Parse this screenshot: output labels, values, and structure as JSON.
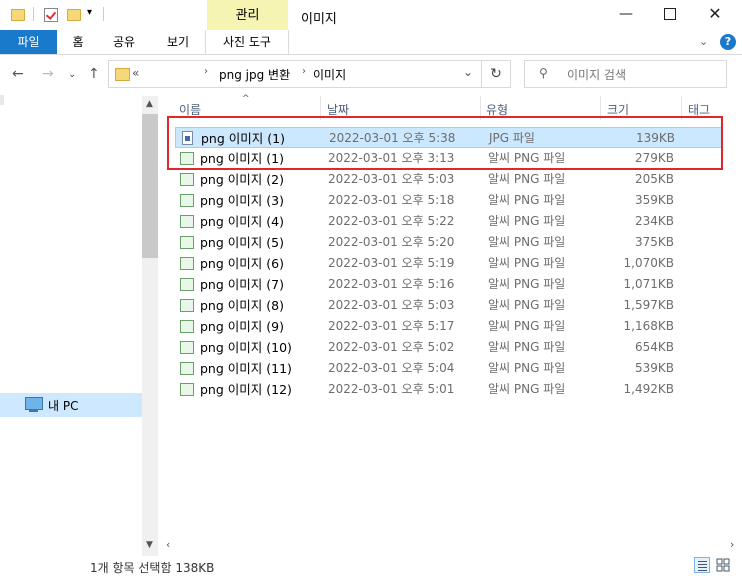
{
  "window": {
    "manage_tab": "관리",
    "title": "이미지"
  },
  "ribbon": {
    "file": "파일",
    "home": "홈",
    "share": "공유",
    "view": "보기",
    "picture_tools": "사진 도구"
  },
  "address": {
    "overflow": "«",
    "crumbs": [
      "png jpg 변환",
      "이미지"
    ],
    "search_placeholder": "이미지 검색"
  },
  "nav": {
    "mypc": "내 PC"
  },
  "columns": {
    "name": "이름",
    "date": "날짜",
    "type": "유형",
    "size": "크기",
    "tag": "태그"
  },
  "files": [
    {
      "name": "png 이미지 (1)",
      "date": "2022-03-01 오후 5:38",
      "type": "JPG 파일",
      "size": "139KB",
      "icon": "jpg-file-icon",
      "selected": true
    },
    {
      "name": "png 이미지 (1)",
      "date": "2022-03-01 오후 3:13",
      "type": "알씨 PNG 파일",
      "size": "279KB",
      "icon": "png-file-icon"
    },
    {
      "name": "png 이미지 (2)",
      "date": "2022-03-01 오후 5:03",
      "type": "알씨 PNG 파일",
      "size": "205KB",
      "icon": "png-file-icon"
    },
    {
      "name": "png 이미지 (3)",
      "date": "2022-03-01 오후 5:18",
      "type": "알씨 PNG 파일",
      "size": "359KB",
      "icon": "png-file-icon"
    },
    {
      "name": "png 이미지 (4)",
      "date": "2022-03-01 오후 5:22",
      "type": "알씨 PNG 파일",
      "size": "234KB",
      "icon": "png-file-icon"
    },
    {
      "name": "png 이미지 (5)",
      "date": "2022-03-01 오후 5:20",
      "type": "알씨 PNG 파일",
      "size": "375KB",
      "icon": "png-file-icon"
    },
    {
      "name": "png 이미지 (6)",
      "date": "2022-03-01 오후 5:19",
      "type": "알씨 PNG 파일",
      "size": "1,070KB",
      "icon": "png-file-icon"
    },
    {
      "name": "png 이미지 (7)",
      "date": "2022-03-01 오후 5:16",
      "type": "알씨 PNG 파일",
      "size": "1,071KB",
      "icon": "png-file-icon"
    },
    {
      "name": "png 이미지 (8)",
      "date": "2022-03-01 오후 5:03",
      "type": "알씨 PNG 파일",
      "size": "1,597KB",
      "icon": "png-file-icon"
    },
    {
      "name": "png 이미지 (9)",
      "date": "2022-03-01 오후 5:17",
      "type": "알씨 PNG 파일",
      "size": "1,168KB",
      "icon": "png-file-icon"
    },
    {
      "name": "png 이미지 (10)",
      "date": "2022-03-01 오후 5:02",
      "type": "알씨 PNG 파일",
      "size": "654KB",
      "icon": "png-file-icon"
    },
    {
      "name": "png 이미지 (11)",
      "date": "2022-03-01 오후 5:04",
      "type": "알씨 PNG 파일",
      "size": "539KB",
      "icon": "png-file-icon"
    },
    {
      "name": "png 이미지 (12)",
      "date": "2022-03-01 오후 5:01",
      "type": "알씨 PNG 파일",
      "size": "1,492KB",
      "icon": "png-file-icon"
    }
  ],
  "status": {
    "text": "1개 항목 선택함 138KB"
  },
  "colors": {
    "accent": "#1979ca",
    "manage_tab_bg": "#f5f4b2",
    "selection": "#cce8ff",
    "highlight": "#e2262e"
  }
}
